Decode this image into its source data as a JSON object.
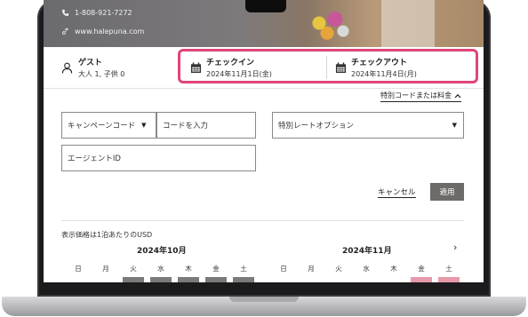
{
  "hero": {
    "phone": "1-808-921-7272",
    "website": "www.halepuna.com"
  },
  "booking_bar": {
    "guest_label": "ゲスト",
    "guest_value": "大人 1, 子供 0",
    "checkin_label": "チェックイン",
    "checkin_value": "2024年11月1日(金)",
    "checkout_label": "チェックアウト",
    "checkout_value": "2024年11月4日(月)"
  },
  "special_code_link": "特別コードまたは料金",
  "form": {
    "campaign_select": "キャンペーンコード",
    "code_placeholder": "コードを入力",
    "special_rate_select": "特別レートオプション",
    "agent_placeholder": "エージェントID",
    "cancel_label": "キャンセル",
    "apply_label": "適用"
  },
  "calendar": {
    "note": "表示価格は1泊あたりのUSD",
    "months": [
      "2024年10月",
      "2024年11月"
    ],
    "weekdays": [
      "日",
      "月",
      "火",
      "水",
      "木",
      "金",
      "土"
    ]
  },
  "colors": {
    "highlight": "#e0457a",
    "apply_button": "#6d6b6a",
    "selected_day": "#e69aa9"
  }
}
